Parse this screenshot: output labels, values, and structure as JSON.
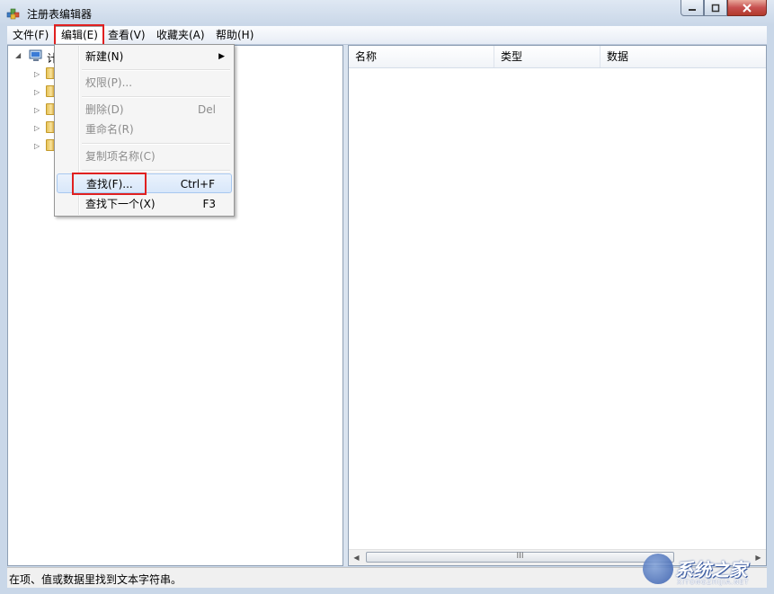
{
  "window": {
    "title": "注册表编辑器",
    "minimize_glyph": "▬",
    "maximize_glyph": "□",
    "close_glyph": "✕"
  },
  "menubar": {
    "items": [
      {
        "label": "文件(F)"
      },
      {
        "label": "编辑(E)"
      },
      {
        "label": "查看(V)"
      },
      {
        "label": "收藏夹(A)"
      },
      {
        "label": "帮助(H)"
      }
    ],
    "active_index": 1
  },
  "edit_menu": {
    "new": {
      "label": "新建(N)",
      "arrow": "▶"
    },
    "permissions": {
      "label": "权限(P)..."
    },
    "delete": {
      "label": "删除(D)",
      "shortcut": "Del"
    },
    "rename": {
      "label": "重命名(R)"
    },
    "copy_key_name": {
      "label": "复制项名称(C)"
    },
    "find": {
      "label": "查找(F)...",
      "shortcut": "Ctrl+F"
    },
    "find_next": {
      "label": "查找下一个(X)",
      "shortcut": "F3"
    }
  },
  "tree": {
    "root_label": "计",
    "child_count": 5
  },
  "list": {
    "columns": [
      "名称",
      "类型",
      "数据"
    ],
    "scroll_grip": "III"
  },
  "statusbar": {
    "text": "在项、值或数据里找到文本字符串。"
  },
  "watermark": {
    "text": "系统之家",
    "sub": "XITONGZHIJIA.NET"
  },
  "colors": {
    "highlight_box": "#e02020",
    "close_button": "#c75050"
  }
}
